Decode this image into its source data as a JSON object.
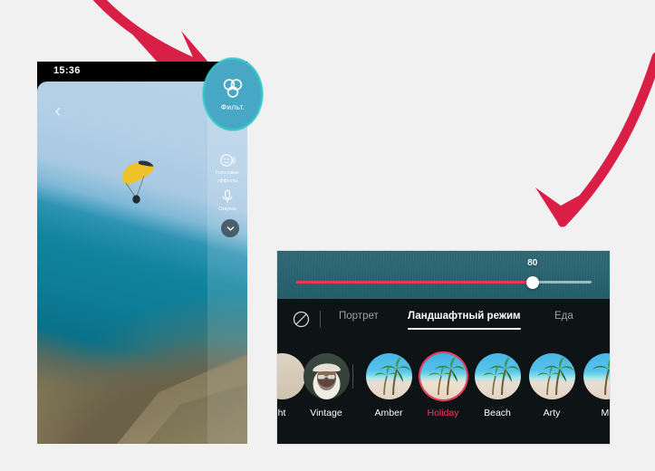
{
  "background_color": "#f1f1f1",
  "annotations": {
    "arrow_color": "#d91f46",
    "arrow_top": {
      "name": "arrow-pointing-to-filter-button"
    },
    "arrow_right": {
      "name": "arrow-pointing-to-filter-panel"
    }
  },
  "phone": {
    "status_bar": {
      "time": "15:36"
    },
    "back_button_icon": "chevron-left-icon",
    "tools": [
      {
        "id": "voice-effects",
        "icon": "smiley-sound-icon",
        "label_line1": "Голосовые",
        "label_line2": "эффекты"
      },
      {
        "id": "voiceover",
        "icon": "microphone-icon",
        "label_line1": "Озвучка",
        "label_line2": ""
      }
    ],
    "collapse_icon": "chevron-down-icon",
    "filter_button": {
      "label": "Фильт.",
      "icon": "three-circles-filter-icon",
      "highlight_ring_color": "#34c6c6",
      "fill_color": "#49a7c6"
    }
  },
  "panel": {
    "slider": {
      "value": "80",
      "value_number": 80,
      "min": 0,
      "max": 100,
      "fill_color": "#e8384f",
      "knob_color": "#ffffff"
    },
    "none_filter_icon": "no-filter-circle-slash-icon",
    "tabs": [
      {
        "id": "portrait",
        "label": "Портрет",
        "active": false
      },
      {
        "id": "landscape",
        "label": "Ландшафтный режим",
        "active": true
      },
      {
        "id": "food",
        "label": "Еда",
        "active": false
      }
    ],
    "active_tab_color": "#ffffff",
    "inactive_tab_color": "#9aa3a8",
    "selected_filter_color": "#ef3e63",
    "filters": [
      {
        "id": "bright",
        "name": "ht",
        "kind": "portrait",
        "selected": false,
        "partial": true
      },
      {
        "id": "vintage",
        "name": "Vintage",
        "kind": "portrait",
        "selected": false,
        "partial": false
      },
      {
        "id": "amber",
        "name": "Amber",
        "kind": "landscape",
        "selected": false,
        "partial": false
      },
      {
        "id": "holiday",
        "name": "Holiday",
        "kind": "landscape",
        "selected": true,
        "partial": false
      },
      {
        "id": "beach",
        "name": "Beach",
        "kind": "landscape",
        "selected": false,
        "partial": false
      },
      {
        "id": "arty",
        "name": "Arty",
        "kind": "landscape",
        "selected": false,
        "partial": false
      },
      {
        "id": "mist",
        "name": "Mi",
        "kind": "landscape",
        "selected": false,
        "partial": true
      }
    ]
  }
}
